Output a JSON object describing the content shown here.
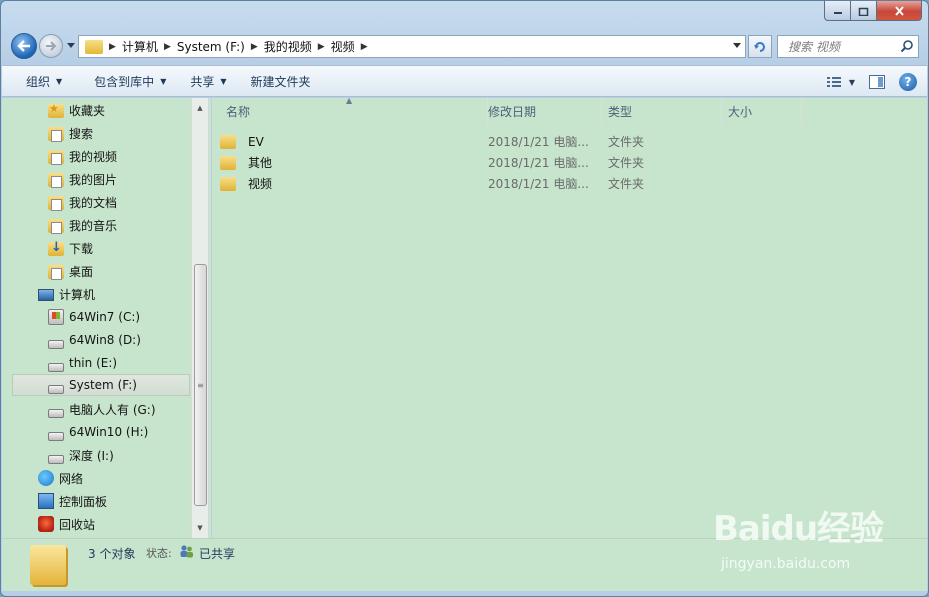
{
  "window": {
    "minimize_glyph": "0",
    "maximize_glyph": "1",
    "close_glyph": "x"
  },
  "address": {
    "crumbs": [
      "计算机",
      "System (F:)",
      "我的视频",
      "视频"
    ]
  },
  "search": {
    "placeholder": "搜索 视频"
  },
  "toolbar": {
    "organize": "组织",
    "include_in_library": "包含到库中",
    "share": "共享",
    "new_folder": "新建文件夹"
  },
  "nav": {
    "items": [
      {
        "label": "收藏夹",
        "icon": "favorites-folder-icon"
      },
      {
        "label": "搜索",
        "icon": "search-folder-icon"
      },
      {
        "label": "我的视频",
        "icon": "library-folder-icon"
      },
      {
        "label": "我的图片",
        "icon": "library-folder-icon"
      },
      {
        "label": "我的文档",
        "icon": "library-folder-icon"
      },
      {
        "label": "我的音乐",
        "icon": "library-folder-icon"
      },
      {
        "label": "下载",
        "icon": "download-folder-icon"
      },
      {
        "label": "桌面",
        "icon": "desktop-folder-icon"
      },
      {
        "label": "计算机",
        "icon": "computer-icon"
      },
      {
        "label": "64Win7  (C:)",
        "icon": "windows-drive-icon"
      },
      {
        "label": "64Win8  (D:)",
        "icon": "drive-icon"
      },
      {
        "label": "thin (E:)",
        "icon": "drive-icon"
      },
      {
        "label": "System (F:)",
        "icon": "drive-icon",
        "selected": true
      },
      {
        "label": "电脑人人有 (G:)",
        "icon": "drive-icon"
      },
      {
        "label": "64Win10 (H:)",
        "icon": "drive-icon"
      },
      {
        "label": "深度 (I:)",
        "icon": "drive-icon"
      },
      {
        "label": "网络",
        "icon": "network-icon"
      },
      {
        "label": "控制面板",
        "icon": "control-panel-icon"
      },
      {
        "label": "回收站",
        "icon": "recycle-bin-icon"
      }
    ]
  },
  "columns": {
    "name": "名称",
    "modified": "修改日期",
    "type": "类型",
    "size": "大小"
  },
  "files": [
    {
      "name": "EV",
      "modified": "2018/1/21 电脑...",
      "type": "文件夹"
    },
    {
      "name": "其他",
      "modified": "2018/1/21 电脑...",
      "type": "文件夹"
    },
    {
      "name": "视频",
      "modified": "2018/1/21 电脑...",
      "type": "文件夹"
    }
  ],
  "details": {
    "count": "3 个对象",
    "state_label": "状态:",
    "state_value": "已共享"
  },
  "watermark": {
    "brand": "Baidu经验",
    "site": "jingyan.baidu.com"
  },
  "colors": {
    "pane_background": "#c7e5cd",
    "frame": "#b7cfe6",
    "toolbar_text": "#1e395b"
  }
}
